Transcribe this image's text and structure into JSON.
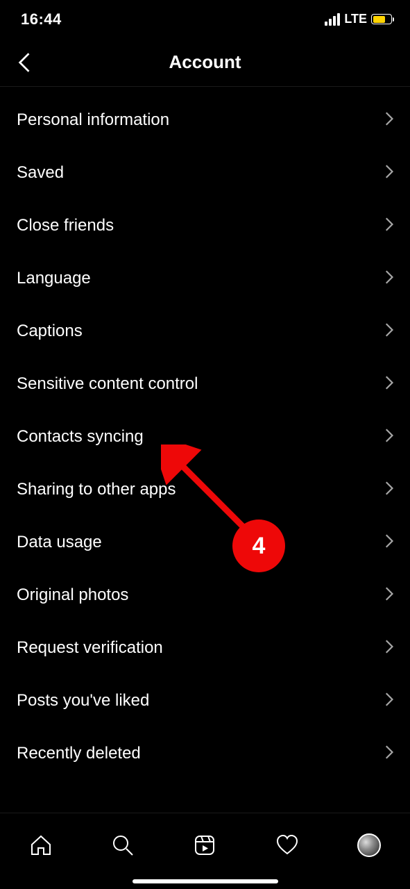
{
  "status": {
    "time": "16:44",
    "network": "LTE"
  },
  "header": {
    "title": "Account"
  },
  "rows": [
    {
      "label": "Personal information"
    },
    {
      "label": "Saved"
    },
    {
      "label": "Close friends"
    },
    {
      "label": "Language"
    },
    {
      "label": "Captions"
    },
    {
      "label": "Sensitive content control"
    },
    {
      "label": "Contacts syncing"
    },
    {
      "label": "Sharing to other apps"
    },
    {
      "label": "Data usage"
    },
    {
      "label": "Original photos"
    },
    {
      "label": "Request verification"
    },
    {
      "label": "Posts you've liked"
    },
    {
      "label": "Recently deleted"
    }
  ],
  "annotation": {
    "badge": "4"
  }
}
